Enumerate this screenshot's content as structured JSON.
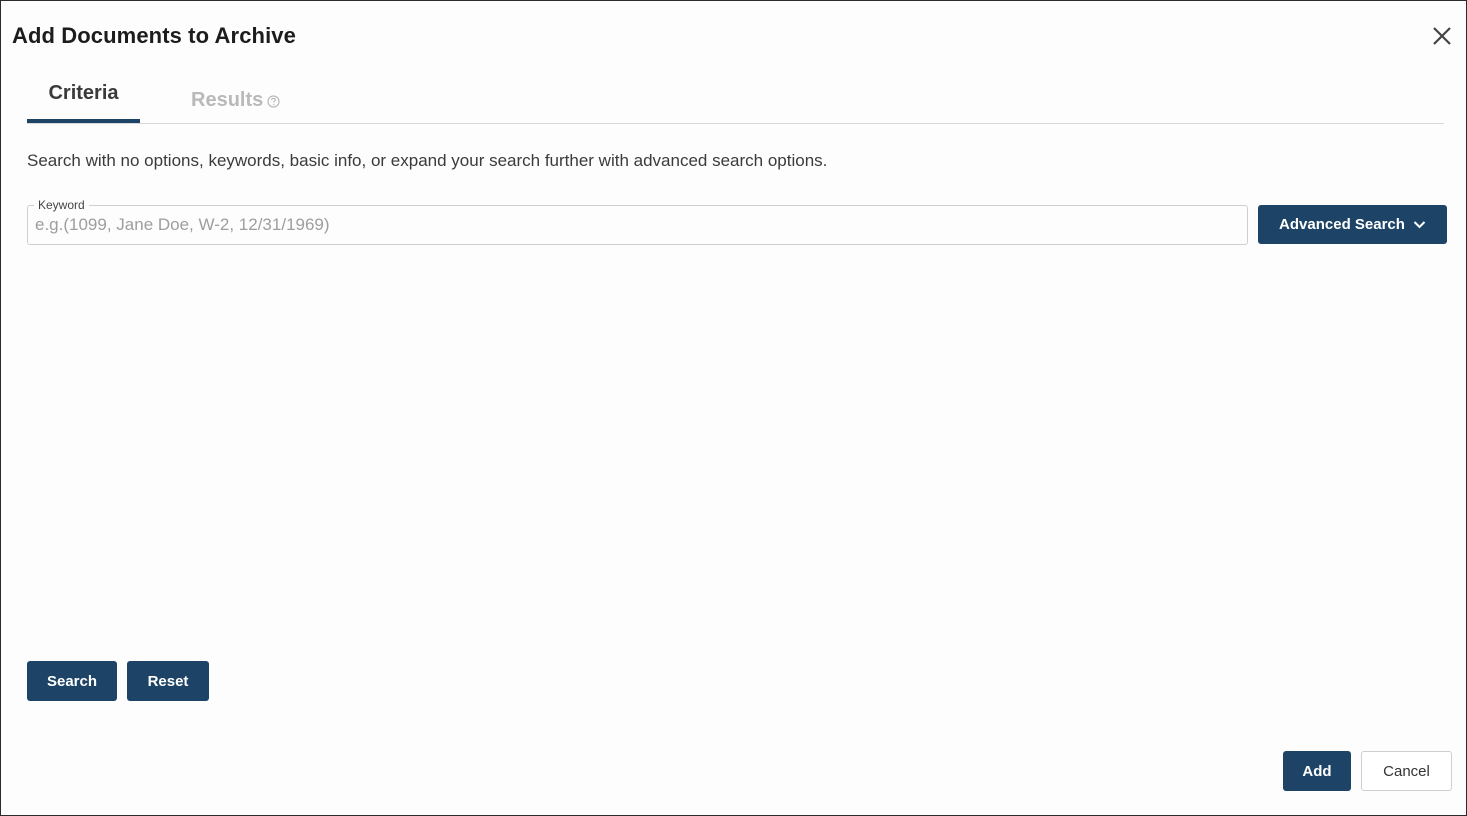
{
  "dialog": {
    "title": "Add Documents to Archive"
  },
  "tabs": [
    {
      "label": "Criteria",
      "active": true
    },
    {
      "label": "Results",
      "active": false
    }
  ],
  "criteria": {
    "description": "Search with no options, keywords, basic info, or expand your search further with advanced search options.",
    "keyword": {
      "label": "Keyword",
      "value": "",
      "placeholder": "e.g.(1099, Jane Doe, W-2, 12/31/1969)"
    },
    "advanced_search_label": "Advanced Search",
    "search_label": "Search",
    "reset_label": "Reset"
  },
  "footer": {
    "add_label": "Add",
    "cancel_label": "Cancel"
  },
  "icons": {
    "close": "close-icon",
    "help": "help-circle-icon",
    "chevron": "chevron-down-icon"
  },
  "colors": {
    "primary": "#1d4466",
    "tab_inactive": "#b9b9b9",
    "border": "#cfcfcf"
  }
}
